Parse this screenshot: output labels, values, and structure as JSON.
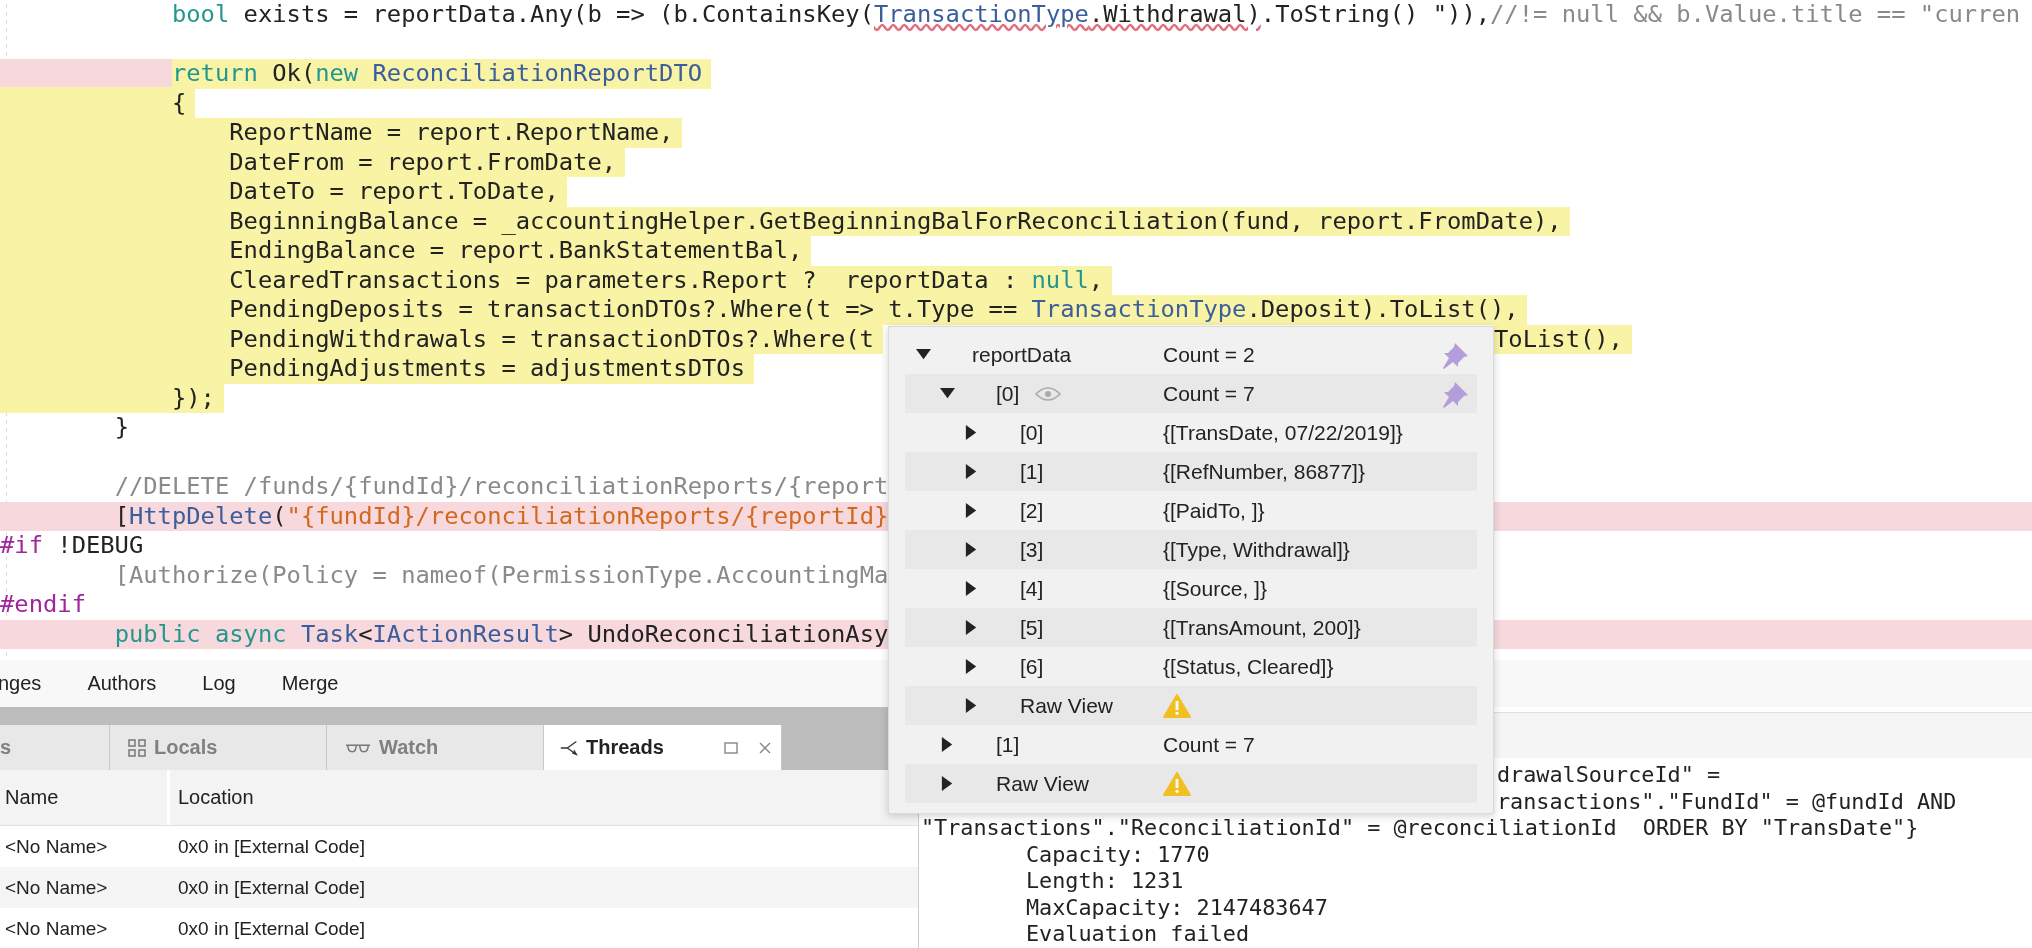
{
  "editor": {
    "lines": [
      {
        "kind": "plain",
        "tokens": [
          {
            "text": "            bool",
            "kind": "keyword"
          },
          {
            "text": " exists = reportData.Any(b => (b.ContainsKey(",
            "kind": "plain"
          },
          {
            "text": "TransactionType",
            "kind": "type-error"
          },
          {
            "text": ".Withdrawal)",
            "kind": "error"
          },
          {
            "text": ".ToString() \")),",
            "kind": "plain"
          },
          {
            "text": "//!= null && b.Value.title == \"curren",
            "kind": "comment"
          }
        ]
      },
      {
        "kind": "blank"
      },
      {
        "kind": "current-breakpoint",
        "tokens": [
          {
            "text": "            return",
            "kind": "keyword"
          },
          {
            "text": " Ok(",
            "kind": "plain"
          },
          {
            "text": "new",
            "kind": "keyword"
          },
          {
            "text": " ReconciliationReportDTO",
            "kind": "type"
          }
        ]
      },
      {
        "kind": "current",
        "tokens": [
          {
            "text": "            {",
            "kind": "plain"
          }
        ]
      },
      {
        "kind": "current",
        "tokens": [
          {
            "text": "                ReportName = report.ReportName,",
            "kind": "plain"
          }
        ]
      },
      {
        "kind": "current",
        "tokens": [
          {
            "text": "                DateFrom = report.FromDate,",
            "kind": "plain"
          }
        ]
      },
      {
        "kind": "current",
        "tokens": [
          {
            "text": "                DateTo = report.ToDate,",
            "kind": "plain"
          }
        ]
      },
      {
        "kind": "current",
        "tokens": [
          {
            "text": "                BeginningBalance = _accountingHelper.GetBeginningBalForReconciliation(fund, report.FromDate),",
            "kind": "plain"
          }
        ]
      },
      {
        "kind": "current",
        "tokens": [
          {
            "text": "                EndingBalance = report.BankStatementBal,",
            "kind": "plain"
          }
        ]
      },
      {
        "kind": "current",
        "tokens": [
          {
            "text": "                ClearedTransactions = parameters.Report ?  reportData : ",
            "kind": "plain"
          },
          {
            "text": "null",
            "kind": "keyword"
          },
          {
            "text": ",",
            "kind": "plain"
          }
        ]
      },
      {
        "kind": "current",
        "tokens": [
          {
            "text": "                PendingDeposits = transactionDTOs?.Where(t => t.Type == ",
            "kind": "plain"
          },
          {
            "text": "TransactionType",
            "kind": "type"
          },
          {
            "text": ".Deposit).ToList(),",
            "kind": "plain"
          }
        ]
      },
      {
        "kind": "current",
        "tokens": [
          {
            "text": "                PendingWithdrawals = transactionDTOs?.Where(t",
            "kind": "plain"
          }
        ],
        "tail": "ToList(),"
      },
      {
        "kind": "current",
        "tokens": [
          {
            "text": "                PendingAdjustments = adjustmentsDTOs",
            "kind": "plain"
          }
        ]
      },
      {
        "kind": "current",
        "tokens": [
          {
            "text": "            });",
            "kind": "plain"
          }
        ]
      },
      {
        "kind": "plain",
        "tokens": [
          {
            "text": "        }",
            "kind": "plain"
          }
        ]
      },
      {
        "kind": "blank"
      },
      {
        "kind": "plain",
        "tokens": [
          {
            "text": "        //DELETE /funds/{fundId}/reconciliationReports/{report",
            "kind": "comment"
          }
        ]
      },
      {
        "kind": "breakpoint",
        "tokens": [
          {
            "text": "        [",
            "kind": "plain"
          },
          {
            "text": "HttpDelete",
            "kind": "type"
          },
          {
            "text": "(",
            "kind": "plain"
          },
          {
            "text": "\"{fundId}/reconciliationReports/{reportId}",
            "kind": "string"
          }
        ]
      },
      {
        "kind": "plain",
        "tokens": [
          {
            "text": "#if",
            "kind": "preprocessor"
          },
          {
            "text": " !DEBUG",
            "kind": "plain"
          }
        ]
      },
      {
        "kind": "plain",
        "tokens": [
          {
            "text": "        [Authorize(Policy = nameof(PermissionType.AccountingMa",
            "kind": "inactive"
          }
        ]
      },
      {
        "kind": "plain",
        "tokens": [
          {
            "text": "#endif",
            "kind": "preprocessor"
          }
        ]
      },
      {
        "kind": "breakpoint",
        "tokens": [
          {
            "text": "        public",
            "kind": "keyword"
          },
          {
            "text": " async",
            "kind": "keyword"
          },
          {
            "text": " Task",
            "kind": "type"
          },
          {
            "text": "<",
            "kind": "plain"
          },
          {
            "text": "IActionResult",
            "kind": "type"
          },
          {
            "text": "> UndoReconciliationAsy",
            "kind": "plain"
          }
        ]
      }
    ]
  },
  "vcs_tabs": [
    "nges",
    "Authors",
    "Log",
    "Merge"
  ],
  "pad_tabs": [
    {
      "label": "s",
      "selected": false
    },
    {
      "label": "Locals",
      "selected": false
    },
    {
      "label": "Watch",
      "selected": false
    },
    {
      "label": "Threads",
      "selected": true
    }
  ],
  "threads": {
    "columns": [
      "Name",
      "Location"
    ],
    "rows": [
      {
        "cells": [
          "<No Name>",
          "0x0 in [External Code]"
        ]
      },
      {
        "cells": [
          "<No Name>",
          "0x0 in [External Code]"
        ]
      },
      {
        "cells": [
          "<No Name>",
          "0x0 in [External Code]"
        ]
      }
    ]
  },
  "output": {
    "lines": [
      {
        "kind": "continued",
        "text": "drawalSourceId\" ="
      },
      {
        "kind": "continued",
        "text": "ransactions\".\"FundId\" = @fundId AND"
      },
      {
        "kind": "plain",
        "text": "\"Transactions\".\"ReconciliationId\" = @reconciliationId  ORDER BY \"TransDate\"}"
      },
      {
        "kind": "plain",
        "text": "        Capacity: 1770"
      },
      {
        "kind": "plain",
        "text": "        Length: 1231"
      },
      {
        "kind": "plain",
        "text": "        MaxCapacity: 2147483647"
      },
      {
        "kind": "plain",
        "text": "        Evaluation failed"
      }
    ]
  },
  "popup": {
    "tree": [
      {
        "name": "reportData",
        "value": "Count = 2",
        "expanded": true,
        "pinned": true,
        "children": [
          {
            "name": "[0]",
            "value": "Count = 7",
            "expanded": true,
            "pinned": true,
            "watch": true,
            "children": [
              {
                "name": "[0]",
                "value": "{[TransDate, 07/22/2019]}",
                "expanded": false
              },
              {
                "name": "[1]",
                "value": "{[RefNumber, 86877]}",
                "expanded": false
              },
              {
                "name": "[2]",
                "value": "{[PaidTo, ]}",
                "expanded": false
              },
              {
                "name": "[3]",
                "value": "{[Type, Withdrawal]}",
                "expanded": false
              },
              {
                "name": "[4]",
                "value": "{[Source, ]}",
                "expanded": false
              },
              {
                "name": "[5]",
                "value": "{[TransAmount, 200]}",
                "expanded": false
              },
              {
                "name": "[6]",
                "value": "{[Status, Cleared]}",
                "expanded": false
              },
              {
                "name": "Raw View",
                "warning": true,
                "expanded": false
              }
            ]
          },
          {
            "name": "[1]",
            "value": "Count = 7",
            "expanded": false
          },
          {
            "name": "Raw View",
            "warning": true,
            "expanded": false
          }
        ]
      }
    ]
  }
}
